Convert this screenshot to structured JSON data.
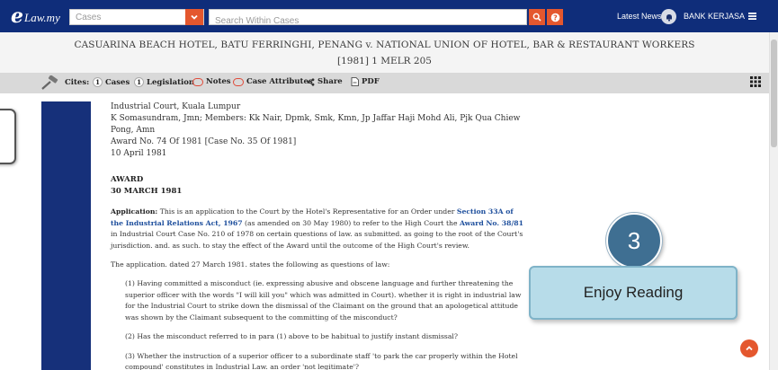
{
  "colors": {
    "topbar": "#0f2d7a",
    "accent": "#e4572e",
    "link": "#1d4e9c",
    "side_bar": "#16307a",
    "step_circle": "#3f6f92",
    "step_label_bg": "#b7dce9"
  },
  "header": {
    "logo_glyph": "e",
    "logo_text": "Law.my",
    "cases_value": "Cases",
    "search_placeholder": "Search Within Cases",
    "latest_news": "Latest News",
    "account_name": "BANK KERJASA"
  },
  "case": {
    "title": "CASUARINA BEACH HOTEL, BATU FERRINGHI, PENANG v. NATIONAL UNION OF HOTEL, BAR & RESTAURANT WORKERS",
    "citation": "[1981] 1 MELR 205"
  },
  "toolbar": {
    "cites_label": "Cites:",
    "cases_count": "1",
    "cases_label": "Cases",
    "legislation_count": "1",
    "legislation_label": "Legislation",
    "notes_label": "Notes",
    "attributes_label": "Case Attributes",
    "share_label": "Share",
    "pdf_label": "PDF"
  },
  "document": {
    "court": "Industrial Court, Kuala Lumpur",
    "panel": "K Somasundram, Jmn; Members: Kk Nair, Dpmk, Smk, Kmn, Jp Jaffar Haji Mohd Ali, Pjk Qua Chiew Pong, Amn",
    "award_no": "Award No. 74 Of 1981 [Case No. 35 Of 1981]",
    "date": "10 April 1981",
    "award_heading": "AWARD",
    "award_date": "30 MARCH 1981",
    "application_label": "Application:",
    "application_p1": " This is an application to the Court by the Hotel's Representative for an Order under ",
    "link_section": "Section 33A of the Industrial Relations Act, 1967",
    "application_p2": " (as amended on 30 May 1980) to refer to the High Court the ",
    "link_award": "Award No. 38/81",
    "application_p3": " in Industrial Court Case No. 210 of 1978 on certain questions of law. as submitted. as going to the root of the Court's jurisdiction. and. as such. to stay the effect of the Award until the outcome of the High Court's review.",
    "stated": "The application. dated 27 March 1981. states the following as questions of law:",
    "q1": "(1) Having committed a misconduct (ie. expressing abusive and obscene language and further threatening the superior officer with the words \"I will kill you\" which was admitted in Court). whether it is right in industrial law for the Industrial Court to strike down the dismissal of the Claimant on the ground that an apologetical attitude was shown by the Claimant subsequent to the committing of the misconduct?",
    "q2": "(2) Has the misconduct referred to in para (1) above to be habitual to justify instant dismissal?",
    "q3": "(3) Whether the instruction of a superior officer to a subordinate staff 'to park the car properly within the Hotel compound' constitutes in Industrial Law. an order 'not legitimate'?"
  },
  "overlay": {
    "step_number": "3",
    "step_label": "Enjoy Reading"
  },
  "icons": [
    "chevron-down-icon",
    "search-icon",
    "help-icon",
    "bell-icon",
    "menu-icon",
    "gavel-icon",
    "share-icon",
    "pdf-icon",
    "grid-icon",
    "chevron-up-icon"
  ]
}
